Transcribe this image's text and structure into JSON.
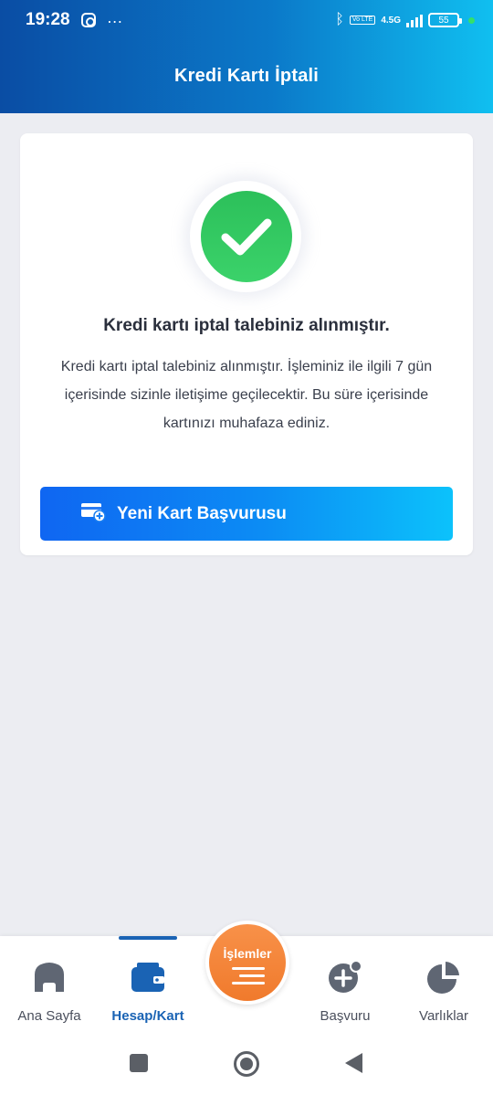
{
  "status_bar": {
    "time": "19:28",
    "network": "4.5G",
    "volte": "Vo LTE",
    "battery": "55",
    "icons": [
      "instagram-icon",
      "more-dots-icon",
      "bluetooth-icon",
      "signal-icon",
      "battery-icon"
    ]
  },
  "header": {
    "title": "Kredi Kartı İptali"
  },
  "card": {
    "icon": "check-circle-icon",
    "heading": "Kredi kartı iptal talebiniz alınmıştır.",
    "body": "Kredi kartı iptal talebiniz alınmıştır. İşleminiz ile ilgili 7 gün içerisinde sizinle iletişime geçilecektir. Bu süre içerisinde kartınızı muhafaza ediniz.",
    "button_label": "Yeni Kart Başvurusu",
    "button_icon": "add-card-icon"
  },
  "bottom_nav": {
    "items": [
      {
        "label": "Ana Sayfa",
        "icon": "home-icon"
      },
      {
        "label": "Hesap/Kart",
        "icon": "wallet-icon",
        "active": true
      },
      {
        "label": "Başvuru",
        "icon": "add-circle-icon"
      },
      {
        "label": "Varlıklar",
        "icon": "pie-chart-icon"
      }
    ],
    "fab_label": "İşlemler",
    "fab_icon": "list-icon"
  },
  "colors": {
    "header_start": "#0a4da4",
    "header_end": "#10bff0",
    "success": "#2cc05a",
    "fab": "#f07a2c",
    "active_nav": "#1a63b4"
  }
}
